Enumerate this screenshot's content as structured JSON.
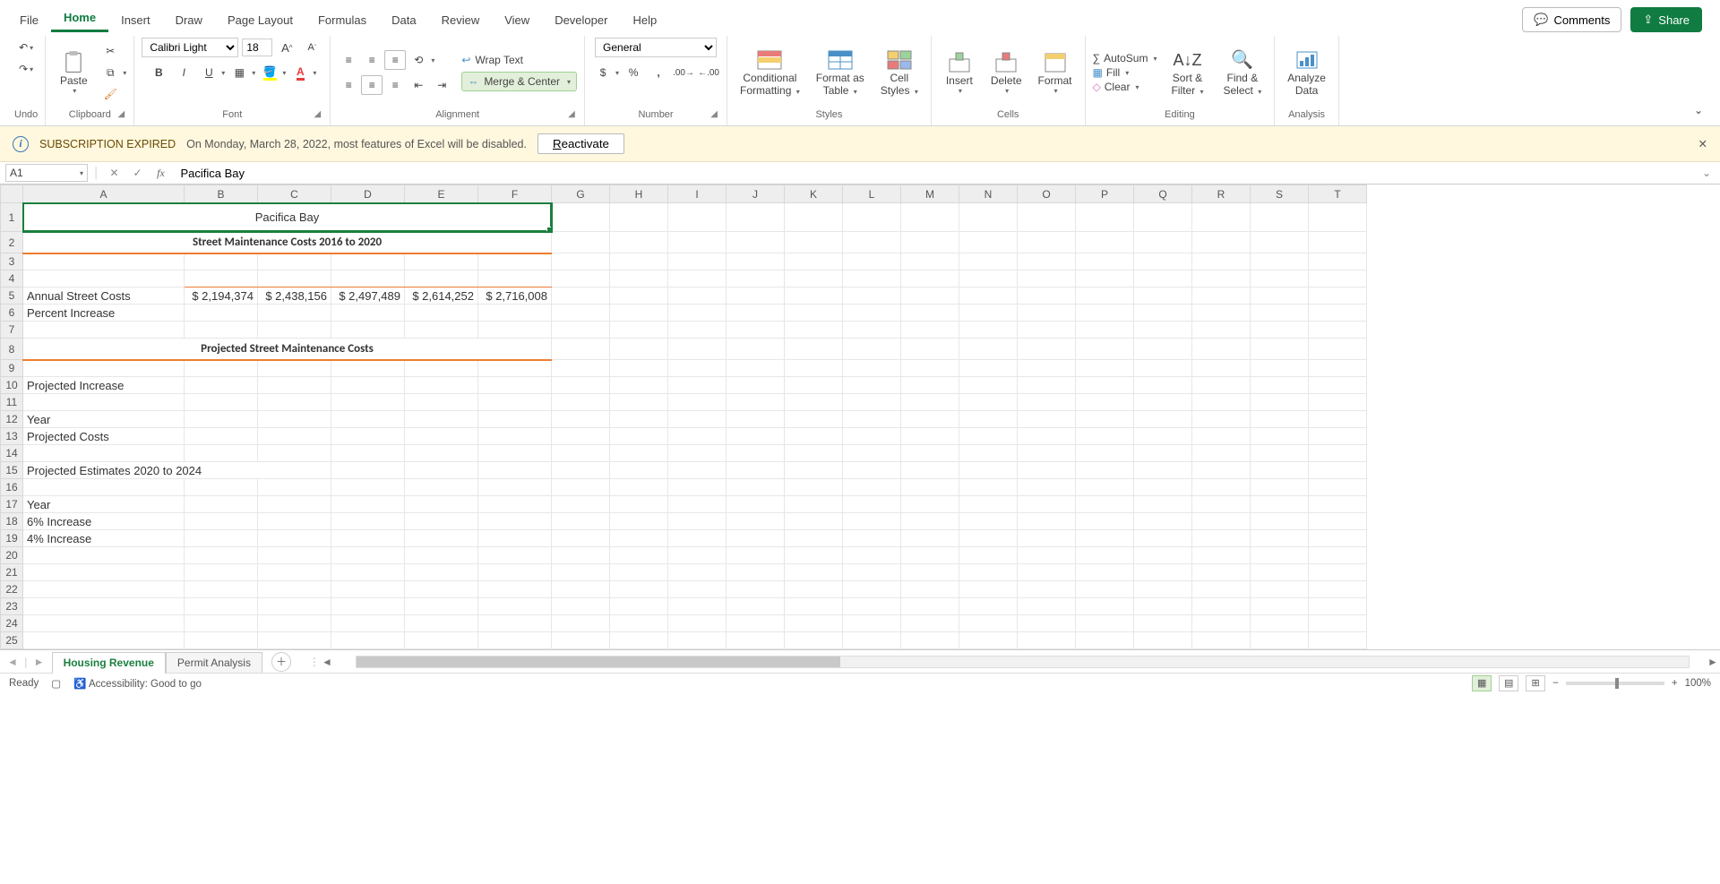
{
  "ribbonTabs": {
    "file": "File",
    "home": "Home",
    "insert": "Insert",
    "draw": "Draw",
    "pageLayout": "Page Layout",
    "formulas": "Formulas",
    "data": "Data",
    "review": "Review",
    "view": "View",
    "developer": "Developer",
    "help": "Help"
  },
  "topButtons": {
    "comments": "Comments",
    "share": "Share"
  },
  "groups": {
    "undo": "Undo",
    "clipboard": "Clipboard",
    "font": "Font",
    "alignment": "Alignment",
    "number": "Number",
    "styles": "Styles",
    "cells": "Cells",
    "editing": "Editing",
    "analysis": "Analysis"
  },
  "ribbon": {
    "paste": "Paste",
    "wrapText": "Wrap Text",
    "mergeCenter": "Merge & Center",
    "fontName": "Calibri Light",
    "fontSize": "18",
    "numberFormat": "General",
    "conditional": "Conditional",
    "formatting": "Formatting",
    "formatAs": "Format as",
    "table": "Table",
    "cell": "Cell",
    "styles2": "Styles",
    "insert": "Insert",
    "delete": "Delete",
    "format": "Format",
    "autoSum": "AutoSum",
    "fill": "Fill",
    "clear": "Clear",
    "sort": "Sort &",
    "filter": "Filter",
    "find": "Find &",
    "select": "Select",
    "analyze": "Analyze",
    "data": "Data"
  },
  "messageBar": {
    "title": "SUBSCRIPTION EXPIRED",
    "body": "On Monday, March 28, 2022, most features of Excel will be disabled.",
    "button": "Reactivate"
  },
  "nameBox": "A1",
  "formula": "Pacifica Bay",
  "columns": [
    "A",
    "B",
    "C",
    "D",
    "E",
    "F",
    "G",
    "H",
    "I",
    "J",
    "K",
    "L",
    "M",
    "N",
    "O",
    "P",
    "Q",
    "R",
    "S",
    "T"
  ],
  "rowCount": 25,
  "cells": {
    "title": "Pacifica Bay",
    "subtitle1": "Street Maintenance Costs 2016 to 2020",
    "r5a": "Annual Street Costs",
    "r5b": "$  2,194,374",
    "r5c": "$  2,438,156",
    "r5d": "$  2,497,489",
    "r5e": "$  2,614,252",
    "r5f": "$  2,716,008",
    "r6a": "Percent Increase",
    "subtitle2": "Projected Street Maintenance Costs",
    "r10a": "Projected Increase",
    "r12a": "Year",
    "r13a": "Projected Costs",
    "r15a": "Projected Estimates 2020 to 2024",
    "r17a": "Year",
    "r18a": "6% Increase",
    "r19a": "4% Increase"
  },
  "sheetTabs": {
    "active": "Housing Revenue",
    "other": "Permit Analysis"
  },
  "status": {
    "ready": "Ready",
    "accessibility": "Accessibility: Good to go",
    "zoom": "100%"
  }
}
